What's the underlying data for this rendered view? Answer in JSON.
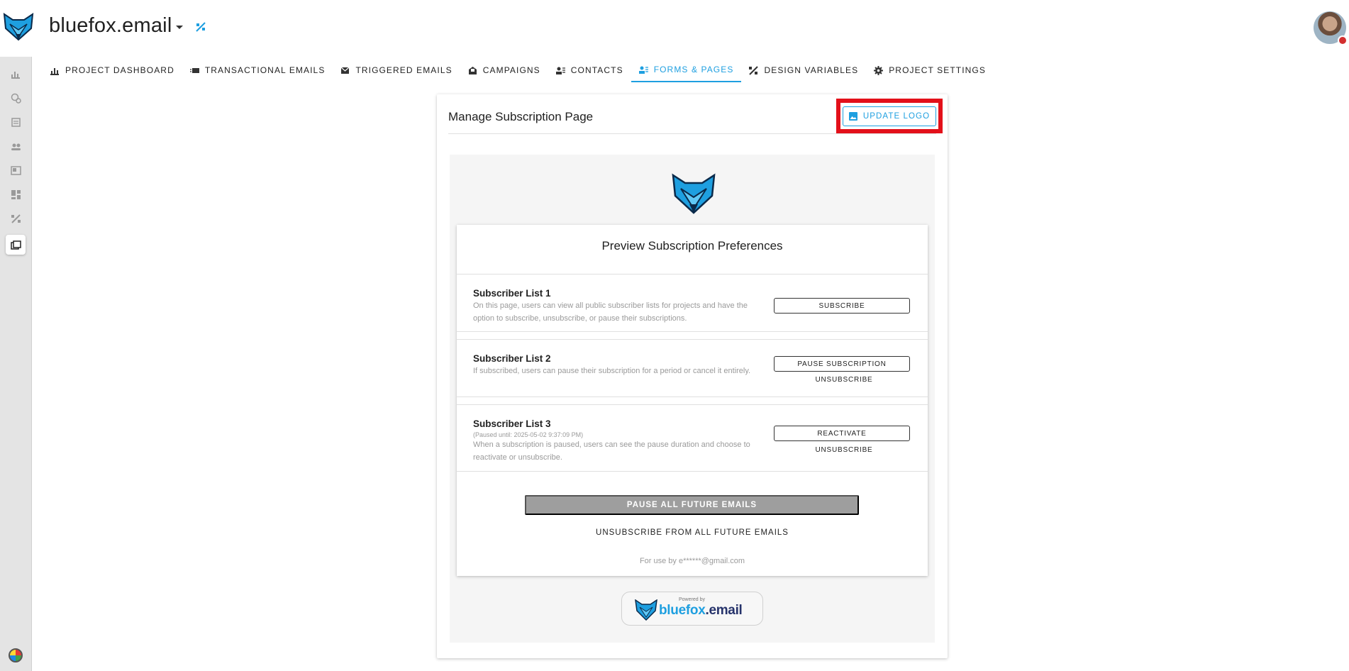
{
  "header": {
    "app_title": "bluefox.email",
    "logo_icon": "fox-logo-icon",
    "avatar_icon": "user-avatar"
  },
  "rail": {
    "items": [
      {
        "icon": "dashboard-chart-icon"
      },
      {
        "icon": "transactional-email-icon"
      },
      {
        "icon": "triggered-email-icon"
      },
      {
        "icon": "contacts-icon"
      },
      {
        "icon": "campaigns-icon"
      },
      {
        "icon": "layout-icon"
      },
      {
        "icon": "design-variables-icon"
      },
      {
        "icon": "forms-pages-icon",
        "active": true
      }
    ]
  },
  "tabs": [
    {
      "label": "PROJECT DASHBOARD",
      "icon": "chart-icon"
    },
    {
      "label": "TRANSACTIONAL EMAILS",
      "icon": "mail-fast-icon"
    },
    {
      "label": "TRIGGERED EMAILS",
      "icon": "mail-icon"
    },
    {
      "label": "CAMPAIGNS",
      "icon": "campaign-icon"
    },
    {
      "label": "CONTACTS",
      "icon": "contacts-icon"
    },
    {
      "label": "FORMS & PAGES",
      "icon": "forms-icon",
      "active": true
    },
    {
      "label": "DESIGN VARIABLES",
      "icon": "design-icon"
    },
    {
      "label": "PROJECT SETTINGS",
      "icon": "gear-icon"
    }
  ],
  "card": {
    "title": "Manage Subscription Page",
    "update_logo_label": "UPDATE LOGO"
  },
  "preview": {
    "title": "Preview Subscription Preferences",
    "lists": [
      {
        "name": "Subscriber List 1",
        "description": "On this page, users can view all public subscriber lists for projects and have the option to subscribe, unsubscribe, or pause their subscriptions.",
        "primary_action": "SUBSCRIBE"
      },
      {
        "name": "Subscriber List 2",
        "description": "If subscribed, users can pause their subscription for a period or cancel it entirely.",
        "primary_action": "PAUSE SUBSCRIPTION",
        "secondary_action": "UNSUBSCRIBE"
      },
      {
        "name": "Subscriber List 3",
        "paused_until": "(Paused until: 2025-05-02 9:37:09 PM)",
        "description": "When a subscription is paused, users can see the pause duration and choose to reactivate or unsubscribe.",
        "primary_action": "REACTIVATE",
        "secondary_action": "UNSUBSCRIBE"
      }
    ],
    "pause_all_label": "PAUSE ALL FUTURE EMAILS",
    "unsubscribe_all_label": "UNSUBSCRIBE FROM ALL FUTURE EMAILS",
    "for_use_by": "For use by e******@gmail.com"
  },
  "powered_by": {
    "label": "Powered by",
    "brand_part1": "bluefox",
    "brand_part2": ".email"
  },
  "colors": {
    "accent": "#1e9fe0",
    "highlight": "#e3101a",
    "disabled_button": "#9e9e9e"
  }
}
